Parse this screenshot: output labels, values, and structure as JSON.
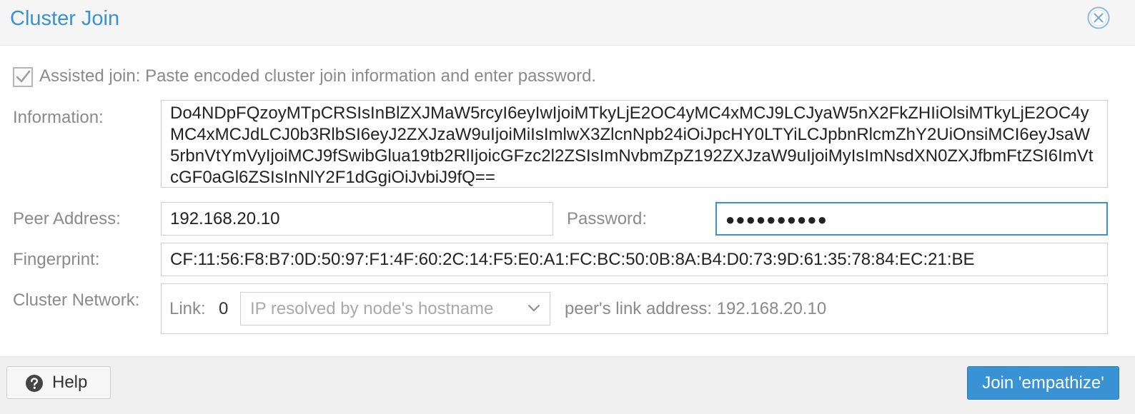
{
  "dialog": {
    "title": "Cluster Join"
  },
  "assisted": {
    "checked": true,
    "label": "Assisted join: Paste encoded cluster join information and enter password."
  },
  "information": {
    "label": "Information:",
    "value": "Do4NDpFQzoyMTpCRSIsInBlZXJMaW5rcyI6eyIwIjoiMTkyLjE2OC4yMC4xMCJ9LCJyaW5nX2FkZHIiOlsiMTkyLjE2OC4yMC4xMCJdLCJ0b3RlbSI6eyJ2ZXJzaW9uIjoiMiIsImlwX3ZlcnNpb24iOiJpcHY0LTYiLCJpbnRlcmZhY2UiOnsiMCI6eyJsaW5rbnVtYmVyIjoiMCJ9fSwibGlua19tb2RlIjoicGFzc2l2ZSIsImNvbmZpZ192ZXJzaW9uIjoiMyIsImNsdXN0ZXJfbmFtZSI6ImVtcGF0aGl6ZSIsInNlY2F1dGgiOiJvbiJ9fQ=="
  },
  "peer": {
    "label": "Peer Address:",
    "value": "192.168.20.10"
  },
  "password": {
    "label": "Password:",
    "masked_value": "●●●●●●●●●●"
  },
  "fingerprint": {
    "label": "Fingerprint:",
    "value": "CF:11:56:F8:B7:0D:50:97:F1:4F:60:2C:14:F5:E0:A1:FC:BC:50:0B:8A:B4:D0:73:9D:61:35:78:84:EC:21:BE"
  },
  "network": {
    "label": "Cluster Network:",
    "link_label": "Link:",
    "link_number": "0",
    "select_value": "IP resolved by node's hostname",
    "peer_link_text": "peer's link address: 192.168.20.10"
  },
  "footer": {
    "help_label": "Help",
    "join_label": "Join 'empathize'"
  },
  "icons": {
    "close": "close-circle-icon",
    "help": "question-circle-icon",
    "dropdown": "chevron-down-icon",
    "checkbox": "checkbox-checked-icon"
  },
  "colors": {
    "accent": "#3892d4",
    "label": "#8a8a8a",
    "footer_bg": "#f0f0f0"
  }
}
